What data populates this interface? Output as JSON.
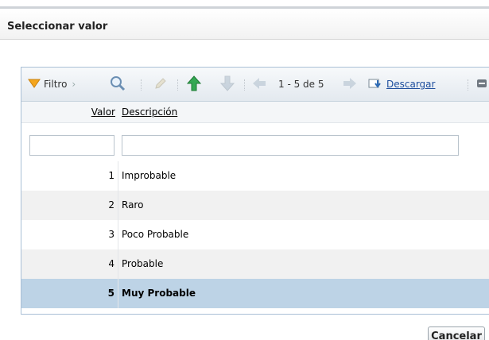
{
  "dialog": {
    "title": "Seleccionar valor"
  },
  "toolbar": {
    "filter_label": "Filtro",
    "pager_text": "1 - 5 de 5",
    "download_label": "Descargar"
  },
  "table": {
    "columns": [
      "Valor",
      "Descripción"
    ],
    "filters": {
      "valor": "",
      "descripcion": ""
    },
    "rows": [
      {
        "valor": "1",
        "descripcion": "Improbable"
      },
      {
        "valor": "2",
        "descripcion": "Raro"
      },
      {
        "valor": "3",
        "descripcion": "Poco Probable"
      },
      {
        "valor": "4",
        "descripcion": "Probable"
      },
      {
        "valor": "5",
        "descripcion": "Muy Probable"
      }
    ],
    "selected_row": "5"
  },
  "footer": {
    "cancel_label": "Cancelar"
  },
  "colors": {
    "selected_row_bg": "#bdd3e6",
    "link": "#1f4f9e",
    "accent_green": "#34a853",
    "funnel": "#f4a51c"
  }
}
